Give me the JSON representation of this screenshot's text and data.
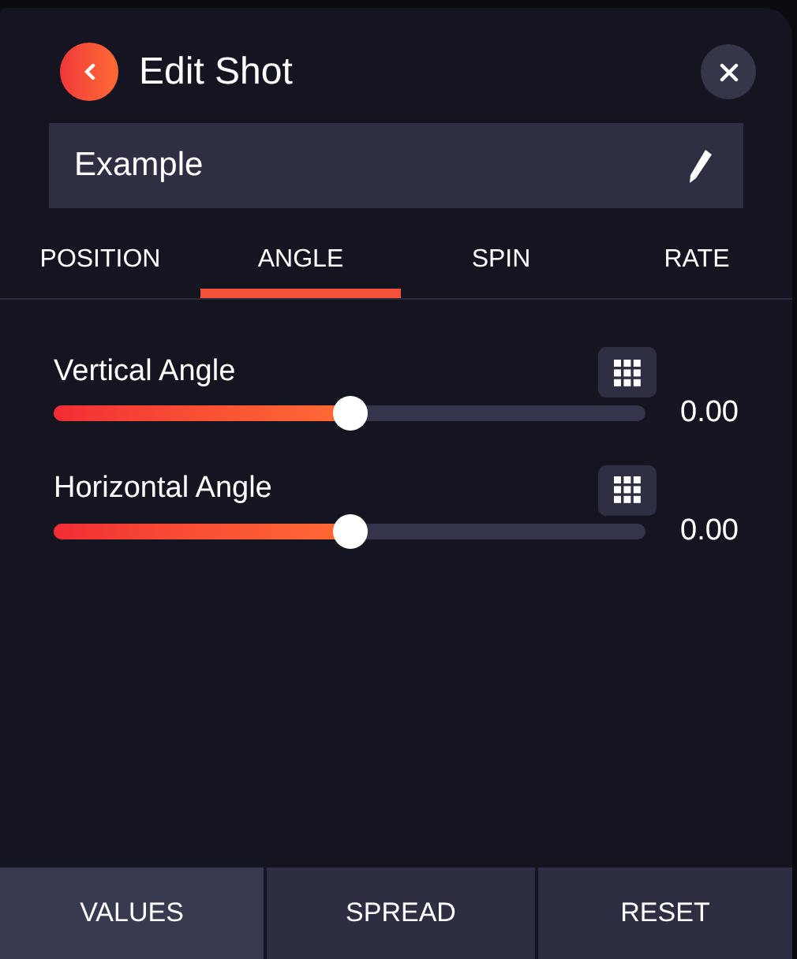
{
  "header": {
    "title": "Edit Shot"
  },
  "name_field": {
    "value": "Example"
  },
  "tabs": [
    {
      "label": "POSITION",
      "selected": false
    },
    {
      "label": "ANGLE",
      "selected": true
    },
    {
      "label": "SPIN",
      "selected": false
    },
    {
      "label": "RATE",
      "selected": false
    }
  ],
  "sliders": [
    {
      "label": "Vertical Angle",
      "level": 0.5,
      "reading": "0.00"
    },
    {
      "label": "Horizontal Angle",
      "level": 0.5,
      "reading": "0.00"
    }
  ],
  "footer_buttons": [
    {
      "label": "VALUES",
      "selected": true
    },
    {
      "label": "SPREAD",
      "selected": false
    },
    {
      "label": "RESET",
      "selected": false
    }
  ]
}
